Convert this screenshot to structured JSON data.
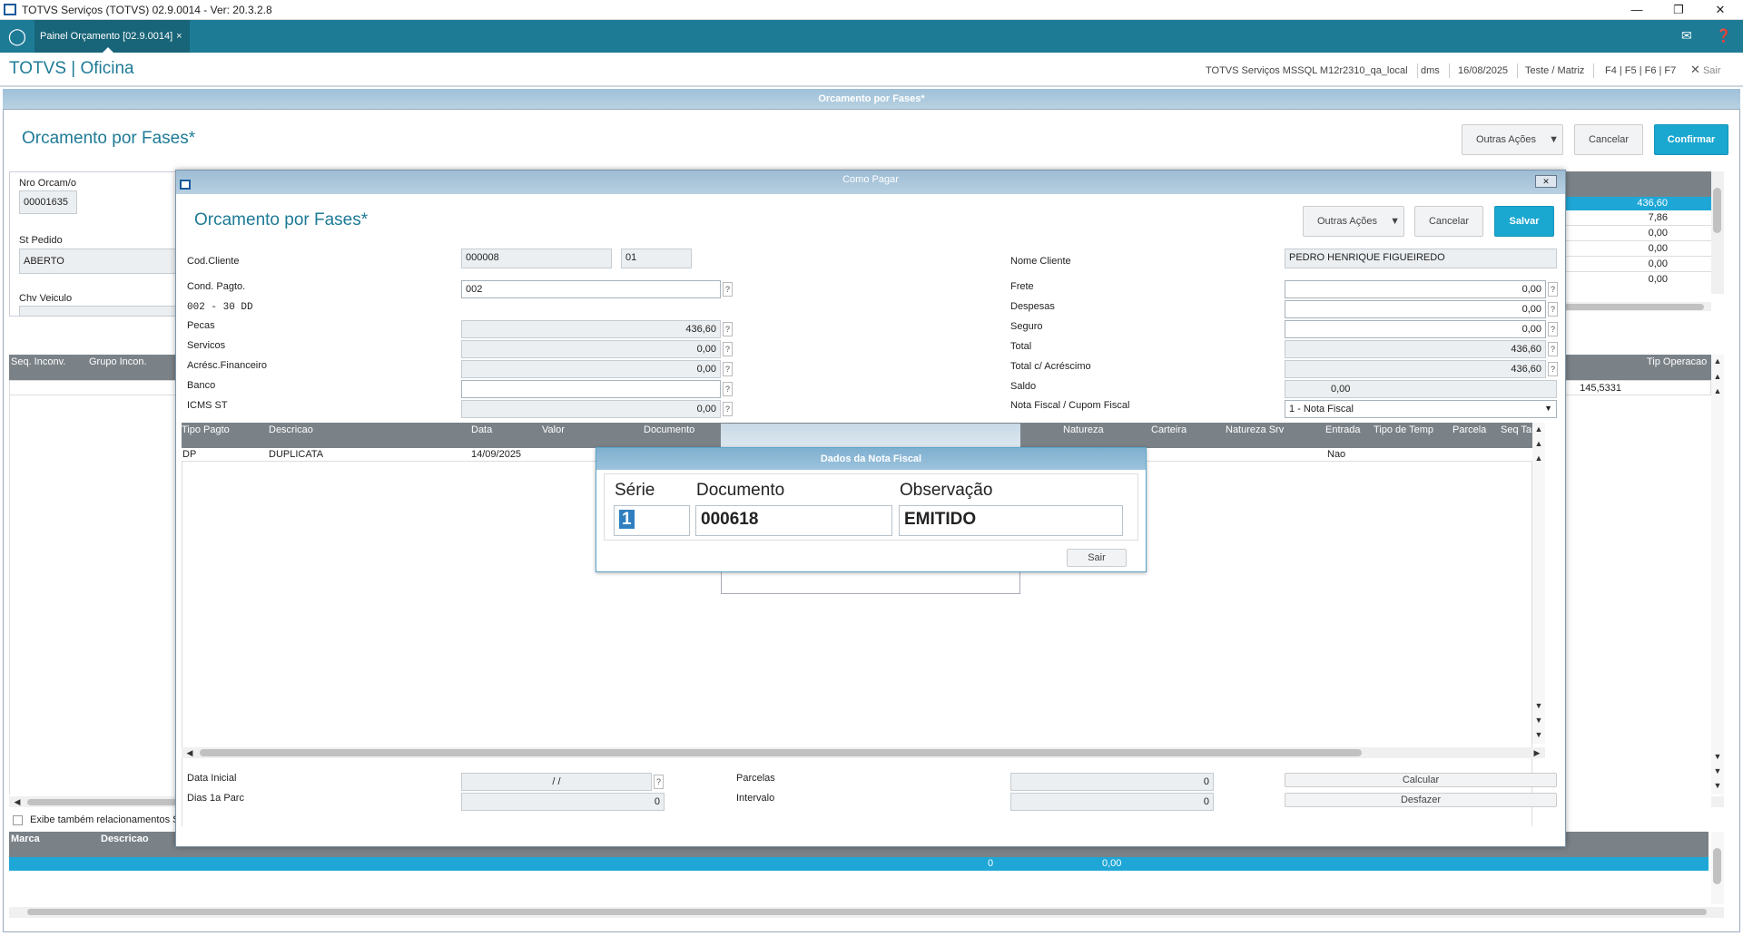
{
  "window": {
    "title": "TOTVS Serviços (TOTVS) 02.9.0014 - Ver: 20.3.2.8"
  },
  "topbar": {
    "tab_label": "Painel Orçamento [02.9.0014]",
    "tab_close": "×"
  },
  "header": {
    "brand": "TOTVS | Oficina",
    "env": "TOTVS Serviços MSSQL M12r2310_qa_local",
    "user": "dms",
    "date": "16/08/2025",
    "company": "Teste / Matriz",
    "shortcuts": "F4 | F5 | F6 | F7",
    "exit": "Sair"
  },
  "main": {
    "frame_title": "Orcamento por Fases*",
    "page_title": "Orcamento por Fases*",
    "other_actions": "Outras Ações",
    "cancel": "Cancelar",
    "confirm": "Confirmar",
    "nro_orcam_label": "Nro Orcam/o",
    "nro_orcam_value": "00001635",
    "st_pedido_label": "St Pedido",
    "st_pedido_value": "ABERTO",
    "chv_veiculo_label": "Chv Veiculo",
    "right_values": [
      "436,60",
      "7,86",
      "0,00",
      "0,00",
      "0,00",
      "0,00"
    ],
    "grid2_headers": [
      "Seq. Inconv.",
      "Grupo Incon."
    ],
    "grid2_right_header": "Tip Operacao",
    "grid2_right_value": "145,5331",
    "checkbox_label": "Exibe também relacionamentos Se",
    "bottom_headers": [
      "Marca",
      "Descricao"
    ],
    "bottom_values": [
      "0",
      "0,00"
    ]
  },
  "dialog": {
    "bar_title": "Como Pagar",
    "title": "Orcamento por Fases*",
    "other_actions": "Outras Ações",
    "cancel": "Cancelar",
    "save": "Salvar",
    "cod_cliente_label": "Cod.Cliente",
    "cod_cliente": "000008",
    "loja": "01",
    "nome_cliente_label": "Nome Cliente",
    "nome_cliente": "PEDRO HENRIQUE FIGUEIREDO",
    "cond_pagto_label": "Cond. Pagto.",
    "cond_pagto": "002",
    "cond_desc": "002 - 30 DD",
    "pecas_label": "Pecas",
    "pecas": "436,60",
    "servicos_label": "Servicos",
    "servicos": "0,00",
    "acresc_label": "Acrésc.Financeiro",
    "acresc": "0,00",
    "banco_label": "Banco",
    "banco": "",
    "icms_label": "ICMS ST",
    "icms": "0,00",
    "frete_label": "Frete",
    "frete": "0,00",
    "despesas_label": "Despesas",
    "despesas": "0,00",
    "seguro_label": "Seguro",
    "seguro": "0,00",
    "total_label": "Total",
    "total": "436,60",
    "total_acresc_label": "Total c/ Acréscimo",
    "total_acresc": "436,60",
    "saldo_label": "Saldo",
    "saldo": "0,00",
    "nf_label": "Nota Fiscal / Cupom Fiscal",
    "nf_value": "1 - Nota Fiscal",
    "grid_headers": [
      "Tipo Pagto",
      "Descricao",
      "Data",
      "Valor",
      "Documento",
      "Natureza",
      "Carteira",
      "Natureza Srv",
      "Entrada",
      "Tipo de Temp",
      "Parcela",
      "Seq Tarefa"
    ],
    "row": {
      "tipo": "DP",
      "descricao": "DUPLICATA",
      "data": "14/09/2025",
      "entrada": "Nao"
    },
    "data_inicial_label": "Data Inicial",
    "data_inicial": " / /",
    "dias_label": "Dias 1a Parc",
    "dias": "0",
    "parcelas_label": "Parcelas",
    "parcelas": "0",
    "intervalo_label": "Intervalo",
    "intervalo": "0",
    "calcular": "Calcular",
    "desfazer": "Desfazer"
  },
  "nf_dialog": {
    "title": "Dados da Nota Fiscal",
    "serie_label": "Série",
    "serie": "1",
    "documento_label": "Documento",
    "documento": "000618",
    "observacao_label": "Observação",
    "observacao": "EMITIDO",
    "sair": "Sair"
  },
  "colors": {
    "accent": "#1e7b96",
    "primary_button": "#1aa7d0",
    "grid_header": "#7a8288",
    "selected": "#1ea7d6"
  }
}
